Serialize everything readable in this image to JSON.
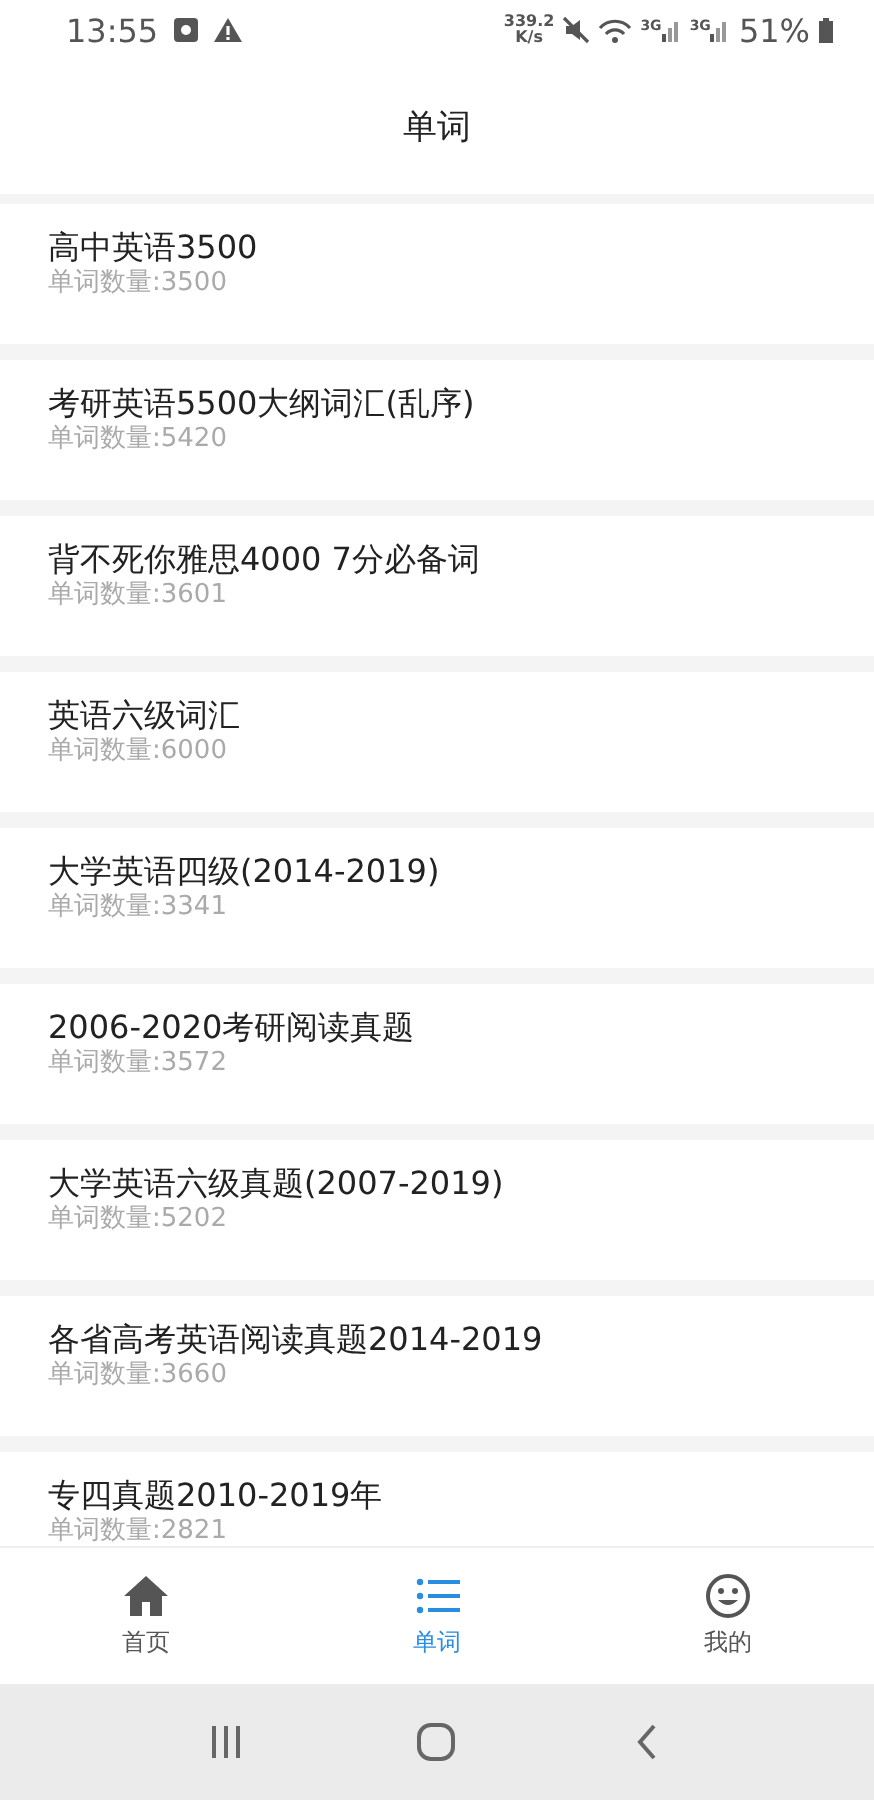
{
  "status_bar": {
    "time": "13:55",
    "speed": "339.2",
    "speed_unit": "K/s",
    "network_1": "3G",
    "network_2": "3G",
    "battery": "51%"
  },
  "header": {
    "title": "单词"
  },
  "books": [
    {
      "title": "高中英语3500",
      "count": "单词数量:3500"
    },
    {
      "title": "考研英语5500大纲词汇(乱序)",
      "count": "单词数量:5420"
    },
    {
      "title": "背不死你雅思4000 7分必备词",
      "count": "单词数量:3601"
    },
    {
      "title": "英语六级词汇",
      "count": "单词数量:6000"
    },
    {
      "title": "大学英语四级(2014-2019)",
      "count": "单词数量:3341"
    },
    {
      "title": "2006-2020考研阅读真题",
      "count": "单词数量:3572"
    },
    {
      "title": "大学英语六级真题(2007-2019)",
      "count": "单词数量:5202"
    },
    {
      "title": "各省高考英语阅读真题2014-2019",
      "count": "单词数量:3660"
    },
    {
      "title": "专四真题2010-2019年",
      "count": "单词数量:2821"
    }
  ],
  "tabs": [
    {
      "label": "首页",
      "kind": "home",
      "selected": false
    },
    {
      "label": "单词",
      "kind": "list",
      "selected": true
    },
    {
      "label": "我的",
      "kind": "face",
      "selected": false
    }
  ]
}
